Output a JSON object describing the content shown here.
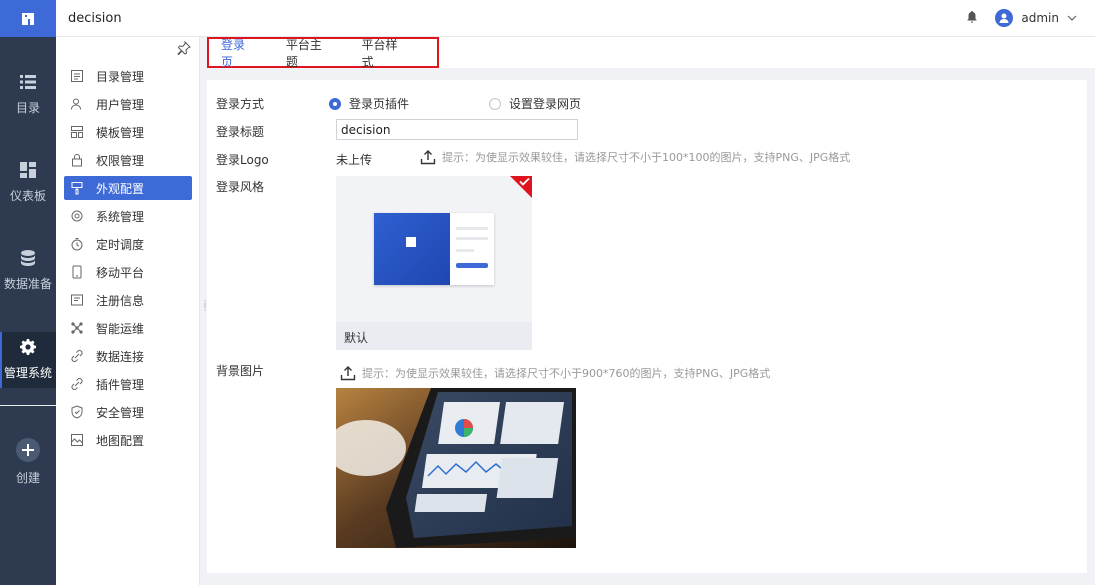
{
  "topbar": {
    "app_title": "decision",
    "user_name": "admin",
    "icons": [
      "app-logo-icon",
      "bell-icon",
      "user-avatar-icon",
      "chevron-down-icon"
    ]
  },
  "leftnav": {
    "items": [
      {
        "label": "目录",
        "icon": "list-icon"
      },
      {
        "label": "仪表板",
        "icon": "dashboard-icon"
      },
      {
        "label": "数据准备",
        "icon": "database-icon"
      },
      {
        "label": "管理系统",
        "icon": "gear-icon",
        "active": true
      },
      {
        "label": "创建",
        "icon": "plus-icon"
      }
    ]
  },
  "submenu": {
    "items": [
      {
        "label": "目录管理",
        "icon": "directory-icon"
      },
      {
        "label": "用户管理",
        "icon": "user-icon"
      },
      {
        "label": "模板管理",
        "icon": "template-icon"
      },
      {
        "label": "权限管理",
        "icon": "lock-icon"
      },
      {
        "label": "外观配置",
        "icon": "paint-brush-icon",
        "active": true
      },
      {
        "label": "系统管理",
        "icon": "settings-icon"
      },
      {
        "label": "定时调度",
        "icon": "timer-icon"
      },
      {
        "label": "移动平台",
        "icon": "mobile-icon"
      },
      {
        "label": "注册信息",
        "icon": "register-icon"
      },
      {
        "label": "智能运维",
        "icon": "network-icon"
      },
      {
        "label": "数据连接",
        "icon": "link-icon"
      },
      {
        "label": "插件管理",
        "icon": "plugin-icon"
      },
      {
        "label": "安全管理",
        "icon": "shield-icon"
      },
      {
        "label": "地图配置",
        "icon": "map-icon"
      }
    ]
  },
  "tabs": [
    {
      "label": "登录页",
      "active": true
    },
    {
      "label": "平台主题"
    },
    {
      "label": "平台样式"
    }
  ],
  "form": {
    "login_method_label": "登录方式",
    "login_method_options": [
      {
        "label": "登录页插件",
        "selected": true
      },
      {
        "label": "设置登录网页",
        "selected": false
      }
    ],
    "login_title_label": "登录标题",
    "login_title_value": "decision",
    "login_logo_label": "登录Logo",
    "login_logo_status": "未上传",
    "login_logo_hint": "提示：为使显示效果较佳，请选择尺寸不小于100*100的图片，支持PNG、JPG格式",
    "login_style_label": "登录风格",
    "login_style_card_label": "默认",
    "background_label": "背景图片",
    "background_hint": "提示：为使显示效果较佳，请选择尺寸不小于900*760的图片，支持PNG、JPG格式"
  },
  "colors": {
    "accent": "#3d6ad6",
    "nav_bg": "#2d3a4f",
    "highlight_border": "#e0141e"
  }
}
